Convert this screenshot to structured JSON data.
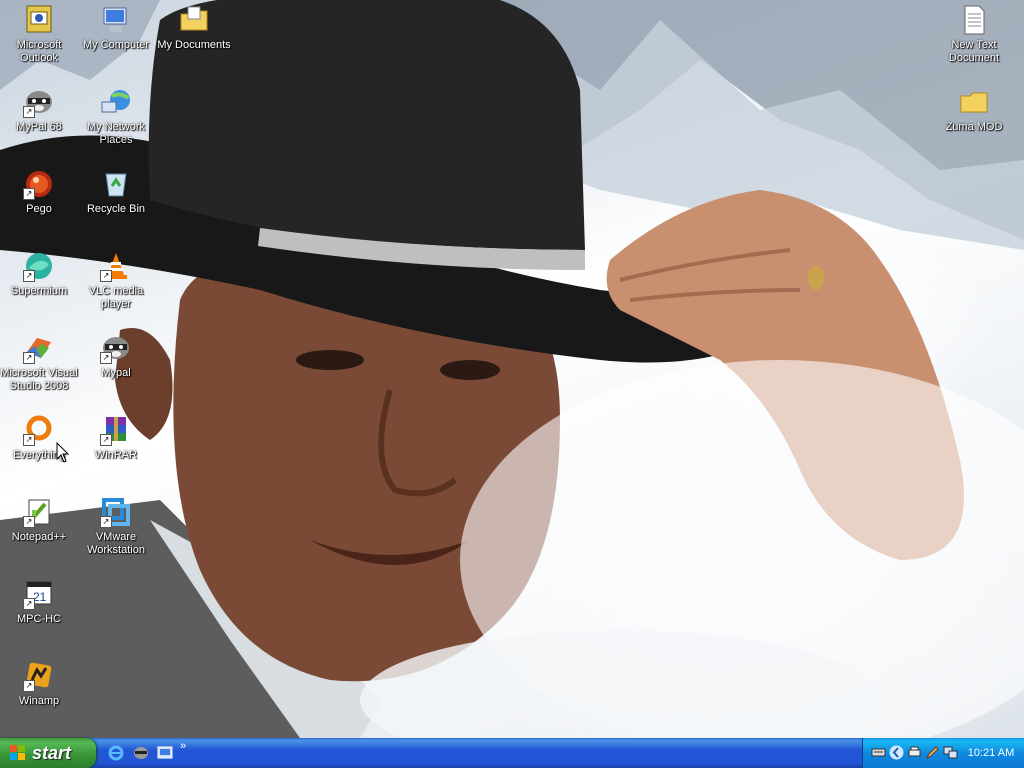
{
  "desktop_icons": [
    {
      "id": "outlook",
      "label": "Microsoft Outlook",
      "icon": "outlook-icon"
    },
    {
      "id": "mycomputer",
      "label": "My Computer",
      "icon": "computer-icon"
    },
    {
      "id": "mydocuments",
      "label": "My Documents",
      "icon": "folder-docs-icon"
    },
    {
      "id": "newtext",
      "label": "New Text Document",
      "icon": "text-document-icon"
    },
    {
      "id": "mypal68",
      "label": "MyPal 68",
      "icon": "raccoon-icon"
    },
    {
      "id": "network",
      "label": "My Network Places",
      "icon": "network-icon"
    },
    {
      "id": "zumamod",
      "label": "Zuma MOD",
      "icon": "folder-icon"
    },
    {
      "id": "pego",
      "label": "Pego",
      "icon": "pego-icon"
    },
    {
      "id": "recycle",
      "label": "Recycle Bin",
      "icon": "recycle-bin-icon"
    },
    {
      "id": "supermium",
      "label": "Supermium",
      "icon": "supermium-icon"
    },
    {
      "id": "vlc",
      "label": "VLC media player",
      "icon": "vlc-cone-icon"
    },
    {
      "id": "msvs",
      "label": "Microsoft Visual Studio 2008",
      "icon": "visual-studio-icon"
    },
    {
      "id": "mypal",
      "label": "Mypal",
      "icon": "raccoon-icon"
    },
    {
      "id": "everything",
      "label": "Everything",
      "icon": "everything-icon"
    },
    {
      "id": "winrar",
      "label": "WinRAR",
      "icon": "winrar-icon"
    },
    {
      "id": "notepadpp",
      "label": "Notepad++",
      "icon": "notepadpp-icon"
    },
    {
      "id": "vmware",
      "label": "VMware Workstation",
      "icon": "vmware-icon"
    },
    {
      "id": "mpchc",
      "label": "MPC-HC",
      "icon": "mpc-hc-icon"
    },
    {
      "id": "winamp",
      "label": "Winamp",
      "icon": "winamp-icon"
    }
  ],
  "taskbar": {
    "start_label": "start",
    "quick_launch": [
      "internet-explorer-icon",
      "raccoon-icon",
      "desktop-icon"
    ],
    "chevron": "»",
    "tray_icons": [
      "keyboard-icon",
      "arrow-icon",
      "printer-icon",
      "pencil-icon",
      "network-icon"
    ],
    "clock": "10:21 AM"
  }
}
